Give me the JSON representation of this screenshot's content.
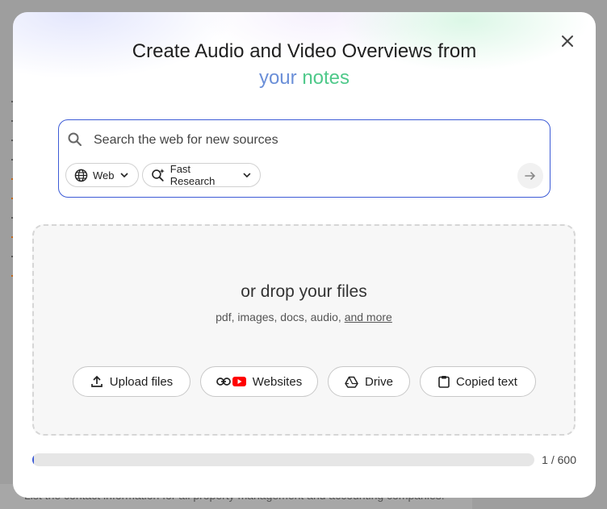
{
  "background": {
    "text": "List the contact information for all property management and accounting companies."
  },
  "modal": {
    "title_line1": "Create Audio and Video Overviews from",
    "title_word1": "your",
    "title_word2": "notes",
    "close_icon": "close-icon"
  },
  "search": {
    "placeholder": "Search the web for new sources",
    "value": "",
    "source_chip": "Web",
    "mode_chip": "Fast Research"
  },
  "drop": {
    "title": "or drop your files",
    "subtitle": "pdf, images, docs, audio,",
    "more_link": "and more",
    "buttons": {
      "upload": "Upload files",
      "websites": "Websites",
      "drive": "Drive",
      "copied": "Copied text"
    }
  },
  "limit": {
    "count": "1 / 600",
    "used": 1,
    "max": 600
  },
  "colors": {
    "accent": "#3c5bd6",
    "your": "#6b8fd8",
    "notes": "#4fc98a",
    "youtube": "#ff0000"
  }
}
